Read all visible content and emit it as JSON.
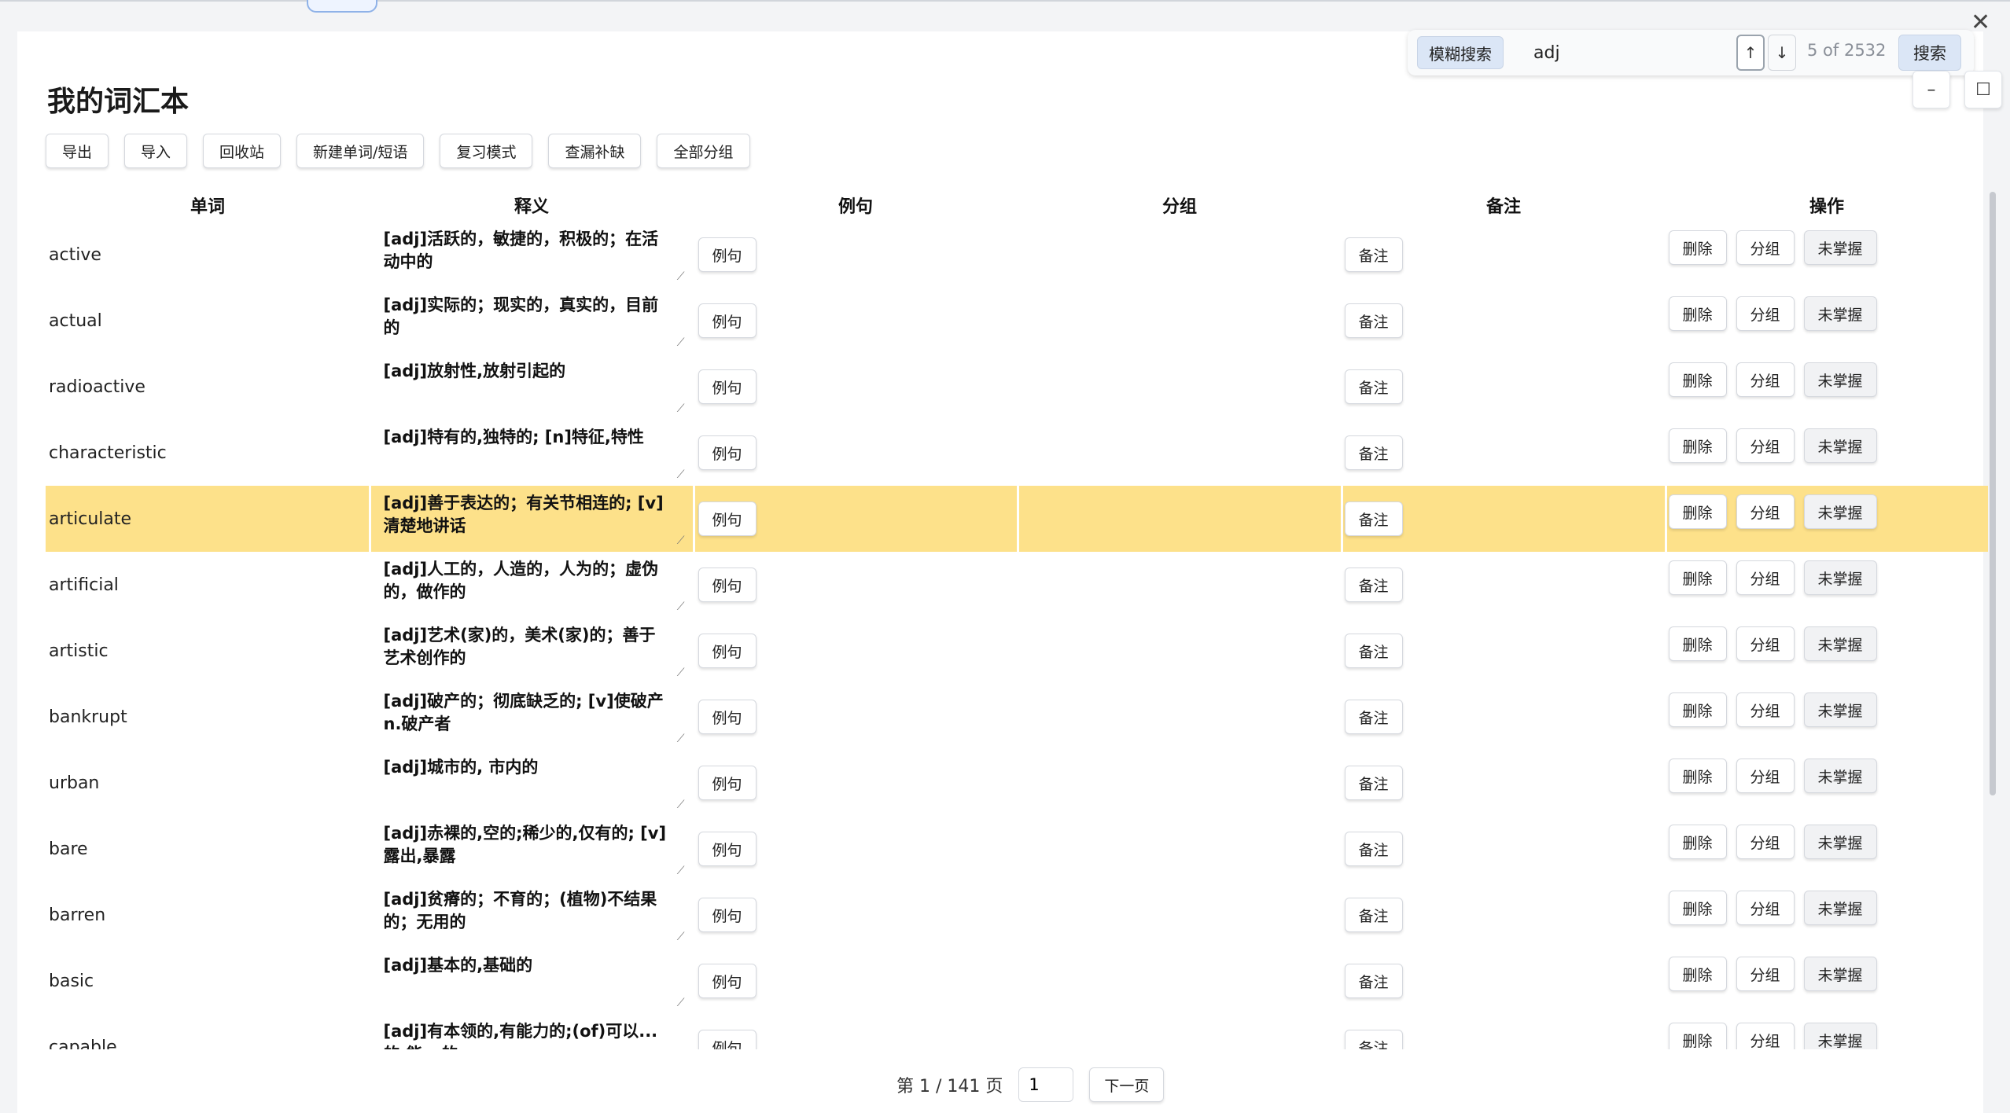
{
  "app": {
    "title": "我的词汇本",
    "menu_icon": "hamburger-menu-icon",
    "close_icon": "close-icon"
  },
  "toolbar": {
    "buttons": [
      "导出",
      "导入",
      "回收站",
      "新建单词/短语",
      "复习模式",
      "查漏补缺",
      "全部分组"
    ]
  },
  "search": {
    "fuzzy_label": "模糊搜索",
    "query": "adj",
    "up_label": "↑",
    "down_label": "↓",
    "count": "5 of 2532",
    "button_label": "搜索"
  },
  "window_controls": {
    "minimize": "–",
    "maximize": "☐"
  },
  "table": {
    "headers": [
      "单词",
      "释义",
      "例句",
      "分组",
      "备注",
      "操作"
    ],
    "example_label": "例句",
    "note_label": "备注",
    "actions": [
      "删除",
      "分组",
      "未掌握"
    ],
    "rows": [
      {
        "word": "active",
        "def": "[adj]活跃的，敏捷的，积极的；在活动中的"
      },
      {
        "word": "actual",
        "def": "[adj]实际的；现实的，真实的，目前的"
      },
      {
        "word": "radioactive",
        "def": "[adj]放射性,放射引起的"
      },
      {
        "word": "characteristic",
        "def": "[adj]特有的,独特的; [n]特征,特性"
      },
      {
        "word": "articulate",
        "def": "[adj]善于表达的；有关节相连的; [v]清楚地讲话"
      },
      {
        "word": "artificial",
        "def": "[adj]人工的，人造的，人为的；虚伪的，做作的"
      },
      {
        "word": "artistic",
        "def": "[adj]艺术(家)的，美术(家)的；善于艺术创作的"
      },
      {
        "word": "bankrupt",
        "def": "[adj]破产的；彻底缺乏的; [v]使破产n.破产者"
      },
      {
        "word": "urban",
        "def": "[adj]城市的, 市内的"
      },
      {
        "word": "bare",
        "def": "[adj]赤裸的,空的;稀少的,仅有的; [v]露出,暴露"
      },
      {
        "word": "barren",
        "def": "[adj]贫瘠的；不育的；(植物)不结果的；无用的"
      },
      {
        "word": "basic",
        "def": "[adj]基本的,基础的"
      },
      {
        "word": "capable",
        "def": "[adj]有本领的,有能力的;(of)可以...的,能...的"
      }
    ],
    "highlight_row": 4,
    "highlight_color": "#fde18a"
  },
  "pagination": {
    "prefix": "第 1 / 141 页",
    "page_value": "1",
    "next_label": "下一页"
  }
}
